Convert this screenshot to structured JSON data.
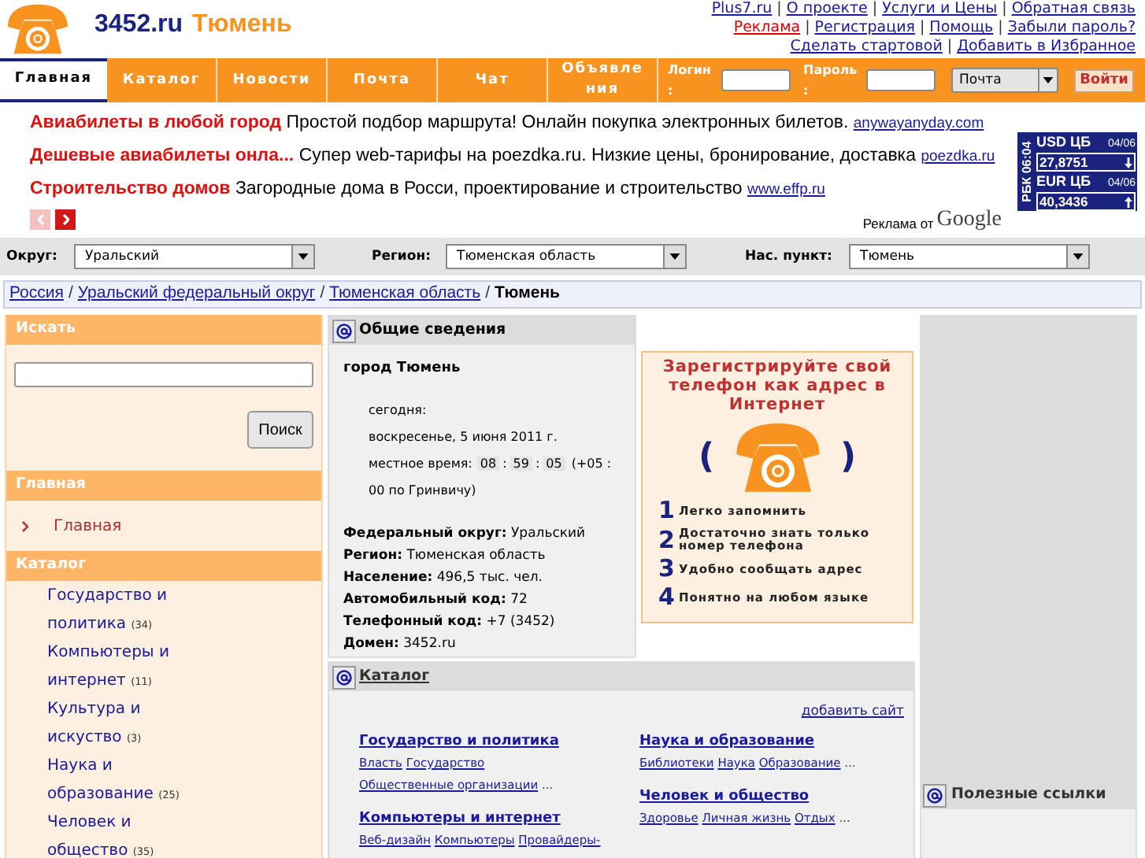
{
  "header": {
    "site": "3452.ru",
    "city": "Тюмень",
    "separator": "|",
    "top_links": [
      [
        {
          "label": "Plus7.ru",
          "highlighted": false
        },
        {
          "label": "О проекте",
          "highlighted": false
        },
        {
          "label": "Услуги и Цены",
          "highlighted": false
        },
        {
          "label": "Обратная связь",
          "highlighted": false
        }
      ],
      [
        {
          "label": "Реклама",
          "highlighted": true
        },
        {
          "label": "Регистрация",
          "highlighted": false
        },
        {
          "label": "Помощь",
          "highlighted": false
        },
        {
          "label": "Забыли пароль?",
          "highlighted": false
        }
      ],
      [
        {
          "label": "Сделать стартовой",
          "highlighted": false
        },
        {
          "label": "Добавить в Избранное",
          "highlighted": false
        }
      ]
    ]
  },
  "nav": {
    "tabs": [
      {
        "label": "Главная",
        "selected": true
      },
      {
        "label": "Каталог",
        "selected": false
      },
      {
        "label": "Новости",
        "selected": false
      },
      {
        "label": "Почта",
        "selected": false
      },
      {
        "label": "Чат",
        "selected": false
      },
      {
        "label": "Объявления",
        "selected": false
      }
    ],
    "login_label": "Логин :",
    "password_label": "Пароль :",
    "mail_select": "Почта",
    "login_button": "Войти"
  },
  "ads": {
    "items": [
      {
        "title": "Авиабилеты в любой город",
        "text": "Простой подбор маршрута! Онлайн покупка электронных билетов.",
        "url": "anywayanyday.com"
      },
      {
        "title": "Дешевые авиабилеты онла...",
        "text": "Супер web-тарифы на poezdka.ru. Низкие цены, бронирование, доставка",
        "url": "poezdka.ru"
      },
      {
        "title": "Строительство домов",
        "text": "Загородные дома в Росси, проектирование и строительство",
        "url": "www.effp.ru"
      }
    ],
    "pager": [
      {
        "kind": "prev",
        "disabled": true
      },
      {
        "kind": "next",
        "disabled": false
      }
    ],
    "by": "Реклама от",
    "brand": "Google"
  },
  "ticker": {
    "clock": "РБК 06:04",
    "rates": [
      {
        "name": "USD ЦБ",
        "date": "04/06",
        "value": "27,8751",
        "rising": false
      },
      {
        "name": "EUR ЦБ",
        "date": "04/06",
        "value": "40,3436",
        "rising": true
      }
    ]
  },
  "filters": [
    {
      "label": "Округ:",
      "value": "Уральский"
    },
    {
      "label": "Регион:",
      "value": "Тюменская область"
    },
    {
      "label": "Нас. пункт:",
      "value": "Тюмень"
    }
  ],
  "breadcrumb": {
    "separator": "/",
    "links": [
      "Россия",
      "Уральский федеральный округ",
      "Тюменская область"
    ],
    "current": "Тюмень"
  },
  "sidebar": {
    "search_title": "Искать",
    "search_button": "Поиск",
    "main_title": "Главная",
    "main_items": [
      {
        "label": "Главная",
        "selected": true
      }
    ],
    "catalog_title": "Каталог",
    "catalog_items": [
      {
        "label": "Государство и политика",
        "count": "(34)"
      },
      {
        "label": "Компьютеры и интернет",
        "count": "(11)"
      },
      {
        "label": "Культура и искуство",
        "count": "(3)"
      },
      {
        "label": "Наука и образование",
        "count": "(25)"
      },
      {
        "label": "Человек и общество",
        "count": "(35)"
      }
    ]
  },
  "info": {
    "title": "Общие сведения",
    "city": "город Тюмень",
    "today_label": "сегодня:",
    "date": "воскресенье, 5 июня 2011 г.",
    "time_label": "местное время:",
    "time": [
      "08",
      ":",
      "59",
      ":",
      "05"
    ],
    "timezone": "(+05 : 00 по Гринвичу)",
    "facts": [
      {
        "label": "Федеральный округ:",
        "value": "Уральский"
      },
      {
        "label": "Регион:",
        "value": "Тюменская область"
      },
      {
        "label": "Население:",
        "value": "496,5 тыс. чел."
      },
      {
        "label": "Автомобильный код:",
        "value": "72"
      },
      {
        "label": "Телефонный код:",
        "value": "+7 (3452)"
      },
      {
        "label": "Домен:",
        "value": "3452.ru"
      }
    ]
  },
  "banner": {
    "title": "Зарегистрируйте свой телефон как адрес в Интернет",
    "left_paren": "(",
    "right_paren": ")",
    "items": [
      {
        "num": "1",
        "text": "Легко запомнить"
      },
      {
        "num": "2",
        "text": "Достаточно знать только номер телефона"
      },
      {
        "num": "3",
        "text": "Удобно сообщать адрес"
      },
      {
        "num": "4",
        "text": "Понятно на любом языке"
      }
    ]
  },
  "catalog": {
    "title": "Каталог",
    "add_link": "добавить сайт",
    "columns": [
      [
        {
          "heading": "Государство и политика",
          "links": [
            "Власть",
            "Государство",
            "Общественные организации"
          ],
          "more": "..."
        },
        {
          "heading": "Компьютеры и интернет",
          "links": [
            "Веб-дизайн",
            "Компьютеры",
            "Провайдеры-"
          ]
        }
      ],
      [
        {
          "heading": "Наука и образование",
          "links": [
            "Библиотеки",
            "Наука",
            "Образование"
          ],
          "more": "..."
        },
        {
          "heading": "Человек и общество",
          "links": [
            "Здоровье",
            "Личная жизнь",
            "Отдых"
          ],
          "more": "..."
        }
      ]
    ]
  },
  "useful": {
    "title": "Полезные ссылки"
  }
}
